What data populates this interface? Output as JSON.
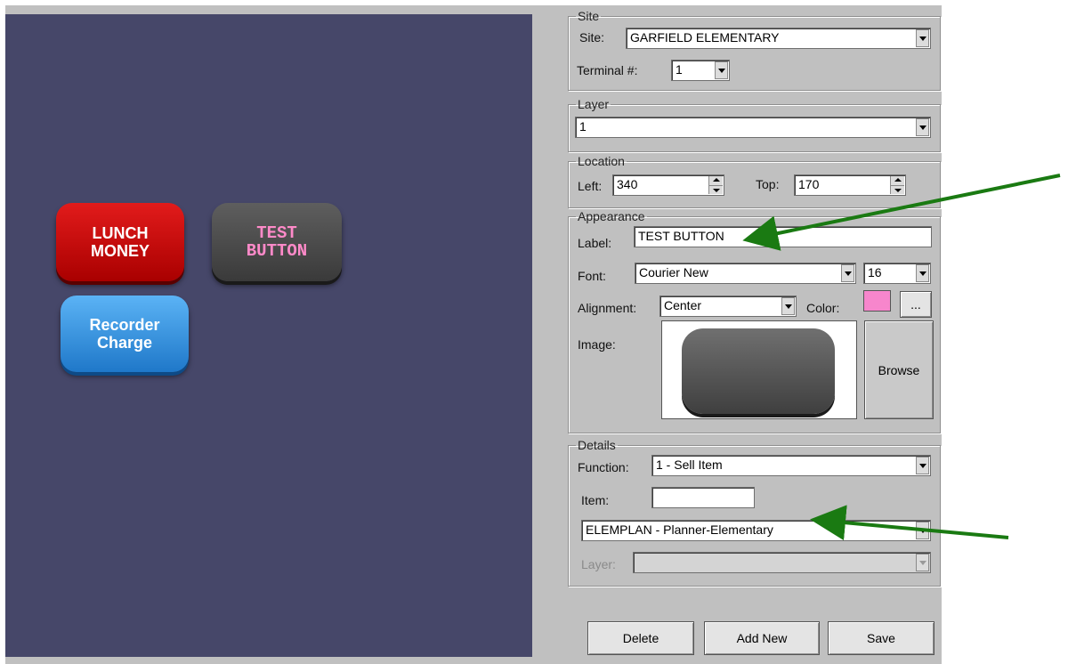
{
  "canvas": {
    "buttons": [
      {
        "label": "LUNCH\nMONEY"
      },
      {
        "label": "TEST\nBUTTON"
      },
      {
        "label": "Recorder\nCharge"
      }
    ]
  },
  "site_group": {
    "legend": "Site",
    "site_label": "Site:",
    "site_value": "GARFIELD ELEMENTARY",
    "terminal_label": "Terminal #:",
    "terminal_value": "1"
  },
  "layer_group": {
    "legend": "Layer",
    "layer_value": "1"
  },
  "location_group": {
    "legend": "Location",
    "left_label": "Left:",
    "left_value": "340",
    "top_label": "Top:",
    "top_value": "170"
  },
  "appearance_group": {
    "legend": "Appearance",
    "label_label": "Label:",
    "label_value": "TEST BUTTON",
    "font_label": "Font:",
    "font_value": "Courier New",
    "font_size_value": "16",
    "alignment_label": "Alignment:",
    "alignment_value": "Center",
    "color_label": "Color:",
    "color_value": "#f786cc",
    "color_picker_label": "...",
    "image_label": "Image:",
    "browse_label": "Browse"
  },
  "details_group": {
    "legend": "Details",
    "function_label": "Function:",
    "function_value": "1 - Sell Item",
    "item_label": "Item:",
    "item_value": "",
    "item_select_value": "ELEMPLAN - Planner-Elementary",
    "layer_label": "Layer:",
    "layer_value": ""
  },
  "actions": {
    "delete_label": "Delete",
    "add_new_label": "Add New",
    "save_label": "Save"
  },
  "annotation_color": "#1a7a12"
}
